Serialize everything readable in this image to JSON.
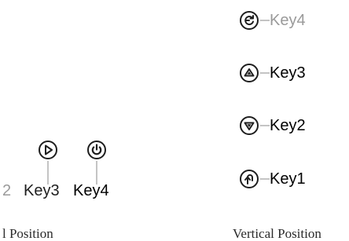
{
  "horizontal_panel": {
    "caption": "l Position",
    "partial_label": "2",
    "keys": [
      {
        "id": "key3",
        "label_word": "Key",
        "label_num": "3",
        "icon": "play-right-icon"
      },
      {
        "id": "key4",
        "label_word": "Key",
        "label_num": "4",
        "icon": "power-icon"
      }
    ]
  },
  "vertical_panel": {
    "caption": "Vertical Position",
    "keys": [
      {
        "id": "key4",
        "label_word": "Key",
        "label_num": "4",
        "icon": "rotate-icon"
      },
      {
        "id": "key3",
        "label_word": "Key",
        "label_num": "3",
        "icon": "triangle-up-icon"
      },
      {
        "id": "key2",
        "label_word": "Key",
        "label_num": "2",
        "icon": "triangle-down-icon"
      },
      {
        "id": "key1",
        "label_word": "Key",
        "label_num": "1",
        "icon": "return-icon"
      }
    ]
  },
  "colors": {
    "label_dark": "#1e1e1e",
    "label_gray": "#9a9a9a",
    "connector": "#c4c4c4"
  }
}
